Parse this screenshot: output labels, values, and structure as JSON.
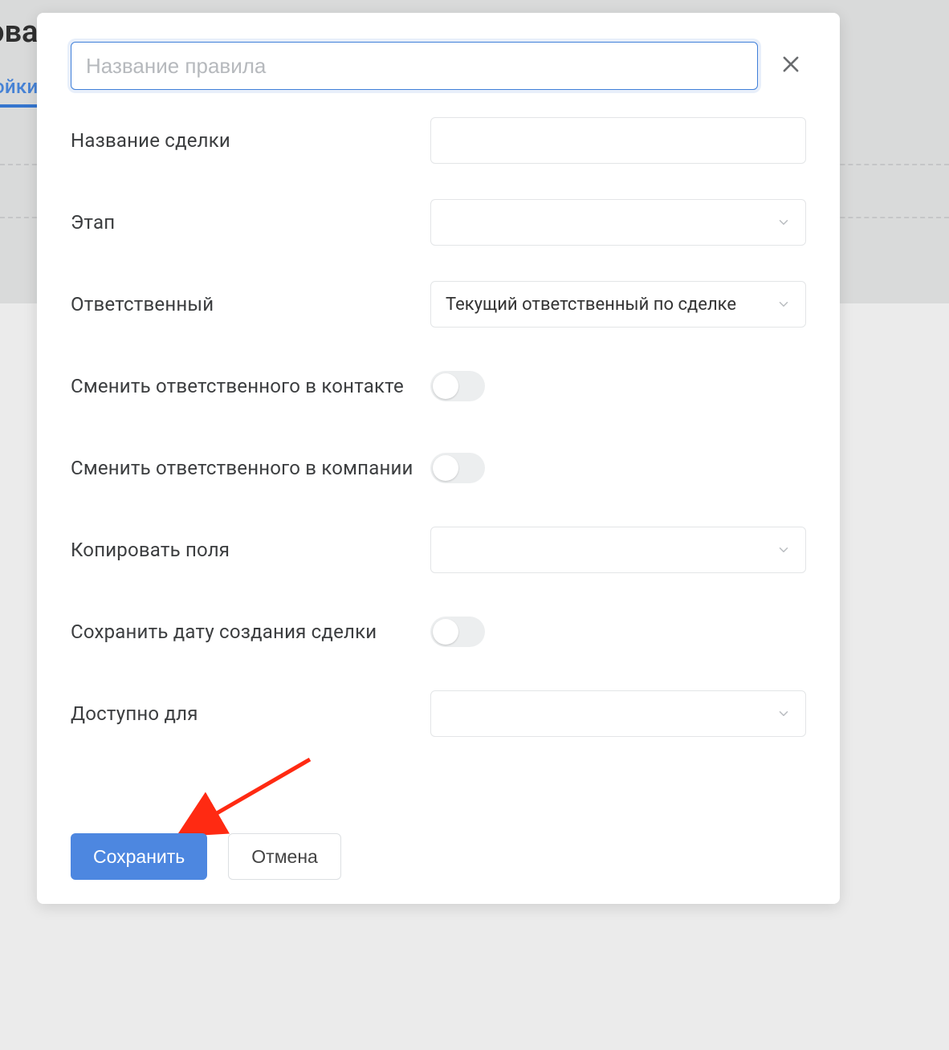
{
  "background": {
    "title_fragment": "ова",
    "tab_fragment": "ойки"
  },
  "modal": {
    "rule_name": {
      "placeholder": "Название правила",
      "value": ""
    },
    "fields": {
      "deal_name": {
        "label": "Название сделки",
        "value": ""
      },
      "stage": {
        "label": "Этап",
        "value": ""
      },
      "responsible": {
        "label": "Ответственный",
        "value": "Текущий ответственный по сделке"
      },
      "change_contact_resp": {
        "label": "Сменить ответственного в контакте",
        "on": false
      },
      "change_company_resp": {
        "label": "Сменить ответственного в компании",
        "on": false
      },
      "copy_fields": {
        "label": "Копировать поля",
        "value": ""
      },
      "keep_created_date": {
        "label": "Сохранить дату создания сделки",
        "on": false
      },
      "available_for": {
        "label": "Доступно для",
        "value": ""
      }
    },
    "actions": {
      "save": "Сохранить",
      "cancel": "Отмена"
    }
  }
}
